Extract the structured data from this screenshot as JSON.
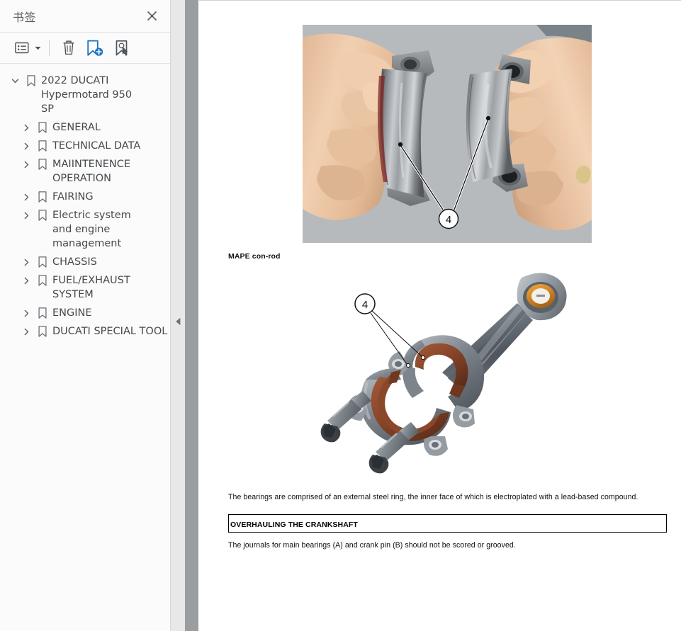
{
  "panel": {
    "title": "书签",
    "close_label": "×",
    "toolbar": {
      "options_icon": "list-options-icon",
      "options_caret_icon": "caret-down-icon",
      "delete_icon": "trash-icon",
      "add_bookmark_icon": "add-bookmark-icon",
      "select_bookmark_icon": "bookmark-pointer-icon"
    },
    "tree": {
      "root": {
        "label": "2022 DUCATI Hypermotard 950 SP",
        "expanded": true,
        "toggle_icon": "chevron-down-icon",
        "bookmark_icon": "bookmark-icon"
      },
      "items": [
        {
          "label": "GENERAL",
          "toggle_icon": "chevron-right-icon",
          "bookmark_icon": "bookmark-icon"
        },
        {
          "label": "TECHNICAL DATA",
          "toggle_icon": "chevron-right-icon",
          "bookmark_icon": "bookmark-icon"
        },
        {
          "label": "MAIINTENENCE OPERATION",
          "toggle_icon": "chevron-right-icon",
          "bookmark_icon": "bookmark-icon"
        },
        {
          "label": "FAIRING",
          "toggle_icon": "chevron-right-icon",
          "bookmark_icon": "bookmark-icon"
        },
        {
          "label": "Electric system and engine management",
          "toggle_icon": "chevron-right-icon",
          "bookmark_icon": "bookmark-icon"
        },
        {
          "label": "CHASSIS",
          "toggle_icon": "chevron-right-icon",
          "bookmark_icon": "bookmark-icon"
        },
        {
          "label": "FUEL/EXHAUST SYSTEM",
          "toggle_icon": "chevron-right-icon",
          "bookmark_icon": "bookmark-icon"
        },
        {
          "label": "ENGINE",
          "toggle_icon": "chevron-right-icon",
          "bookmark_icon": "bookmark-icon"
        },
        {
          "label": "DUCATI SPECIAL TOOL",
          "toggle_icon": "chevron-right-icon",
          "bookmark_icon": "bookmark-icon"
        }
      ]
    },
    "collapse_icon": "collapse-left-arrow-icon"
  },
  "document": {
    "photo": {
      "alt": "Hands holding two con-rod bearing shell halves",
      "callout": "4",
      "background_color": "#b6babd"
    },
    "figure_caption": "MAPE con-rod",
    "lineart": {
      "alt": "Exploded view of connecting rod, bearing shells, cap and bolts",
      "callout": "4",
      "bearing_color": "#8c4a30",
      "metal_color": "#6f757c",
      "bush_color": "#d98e2b"
    },
    "paragraph_bearings": "The bearings are comprised of an external steel ring, the inner face of which is electroplated with a lead-based compound.",
    "section_heading": "OVERHAULING THE CRANKSHAFT",
    "paragraph_journals": "The journals for main bearings (A) and crank pin (B) should not be scored or grooved."
  },
  "colors": {
    "panel_bg": "#fbfbfb",
    "accent_blue": "#1b72c0",
    "icon_gray": "#4f5459",
    "scrollbar": "#9b9ea1",
    "splitter": "#e8e8e8"
  }
}
